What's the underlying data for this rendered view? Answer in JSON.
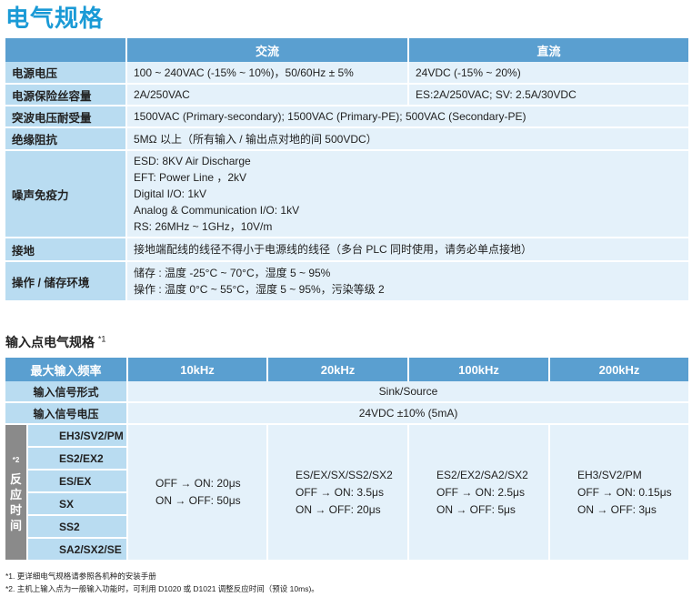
{
  "page_title": "电气规格",
  "spec_table": {
    "headers": [
      "",
      "交流",
      "直流"
    ],
    "rows": [
      {
        "label": "电源电压",
        "ac": "100 ~ 240VAC (-15% ~ 10%)，50/60Hz ± 5%",
        "dc": "24VDC (-15% ~ 20%)"
      },
      {
        "label": "电源保险丝容量",
        "ac": "2A/250VAC",
        "dc": "ES:2A/250VAC; SV: 2.5A/30VDC"
      },
      {
        "label": "突波电压耐受量",
        "merged": "1500VAC (Primary-secondary); 1500VAC (Primary-PE); 500VAC (Secondary-PE)"
      },
      {
        "label": "绝缘阻抗",
        "merged": "5MΩ 以上（所有输入 / 输出点对地的间 500VDC）"
      },
      {
        "label": "噪声免疫力",
        "lines": [
          "ESD: 8KV Air Discharge",
          "EFT: Power Line ，2kV",
          "Digital I/O: 1kV",
          "Analog & Communication I/O: 1kV",
          "RS: 26MHz ~ 1GHz，10V/m"
        ]
      },
      {
        "label": "接地",
        "merged": "接地端配线的线径不得小于电源线的线径（多台 PLC 同时使用，请务必单点接地）"
      },
      {
        "label": "操作 / 储存环境",
        "lines": [
          "储存 : 温度 -25°C ~ 70°C，湿度 5 ~ 95%",
          "操作 : 温度 0°C ~ 55°C，湿度 5 ~ 95%，污染等级 2"
        ]
      }
    ]
  },
  "input_section": {
    "title": "输入点电气规格",
    "title_note": "*1",
    "headers": [
      "最大输入频率",
      "10kHz",
      "20kHz",
      "100kHz",
      "200kHz"
    ],
    "signal_type_label": "输入信号形式",
    "signal_type_value": "Sink/Source",
    "signal_voltage_label": "输入信号电压",
    "signal_voltage_value": "24VDC ±10% (5mA)",
    "side_mark": "*2",
    "side_label": [
      "反",
      "应",
      "时",
      "间"
    ],
    "models": [
      "EH3/SV2/PM",
      "ES2/EX2",
      "ES/EX",
      "SX",
      "SS2",
      "SA2/SX2/SE"
    ],
    "col_10k": [
      "OFF → ON: 20μs",
      "ON → OFF: 50μs"
    ],
    "col_20k": [
      "ES/EX/SX/SS2/SX2",
      "OFF → ON: 3.5μs",
      "ON → OFF: 20μs"
    ],
    "col_100k": [
      "ES2/EX2/SA2/SX2",
      "OFF → ON: 2.5μs",
      "ON → OFF: 5μs"
    ],
    "col_200k": [
      "EH3/SV2/PM",
      "OFF → ON: 0.15μs",
      "ON → OFF: 3μs"
    ]
  },
  "notes": [
    "*1. 更详细电气规格请参照各机种的安装手册",
    "*2. 主机上输入点为一般输入功能时，可利用 D1020 或 D1021 调整反应时间（预设 10ms)。"
  ]
}
